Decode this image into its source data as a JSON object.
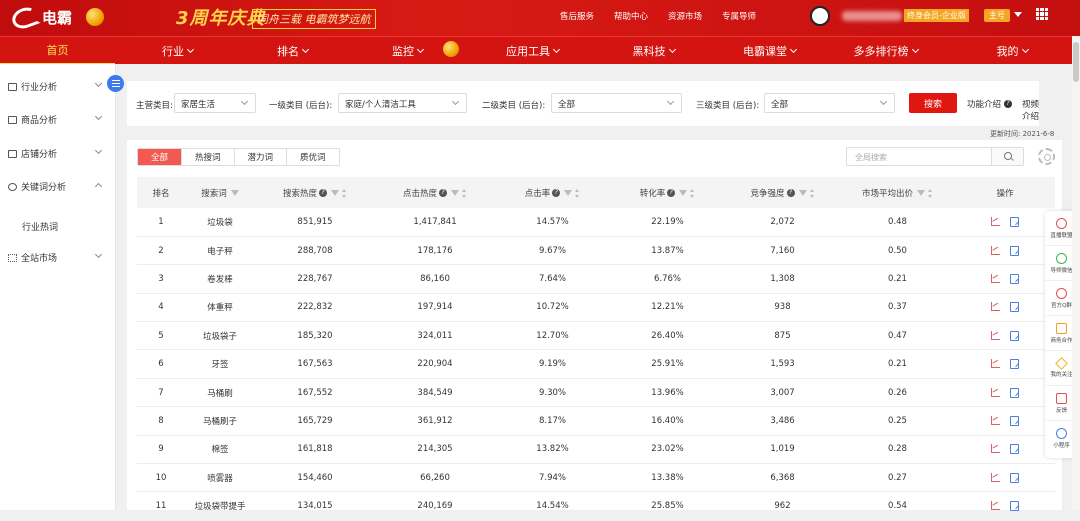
{
  "brand": {
    "logo_text": "电霸",
    "anniv_main": "3周年庆典",
    "anniv_sub": "同舟三载 电霸筑梦远航"
  },
  "top_links": [
    "售后服务",
    "帮助中心",
    "资源市场",
    "专属导师"
  ],
  "user": {
    "vip": "终身会员-企业版",
    "main_badge": "主号"
  },
  "nav": [
    {
      "label": "首页",
      "active": true,
      "has_caret": false
    },
    {
      "label": "行业",
      "has_caret": true
    },
    {
      "label": "排名",
      "has_caret": true
    },
    {
      "label": "监控",
      "has_caret": true
    },
    {
      "label": "应用工具",
      "has_caret": true
    },
    {
      "label": "黑科技",
      "has_caret": true
    },
    {
      "label": "电霸课堂",
      "has_caret": true
    },
    {
      "label": "多多排行榜",
      "has_caret": true
    },
    {
      "label": "我的",
      "has_caret": true
    }
  ],
  "sidebar": {
    "items": [
      {
        "label": "行业分析"
      },
      {
        "label": "商品分析"
      },
      {
        "label": "店铺分析"
      },
      {
        "label": "关键词分析"
      },
      {
        "label": "全站市场"
      }
    ],
    "sub_item": "行业热词"
  },
  "filters": {
    "main_label": "主营类目:",
    "main_value": "家居生活",
    "l1_label": "一级类目 (后台):",
    "l1_value": "家庭/个人清洁工具",
    "l2_label": "二级类目 (后台):",
    "l2_value": "全部",
    "l3_label": "三级类目 (后台):",
    "l3_value": "全部",
    "search_btn": "搜索",
    "func_intro": "功能介绍",
    "video_intro": "视频介绍"
  },
  "update_time": "更新时间: 2021-6-8",
  "tabs": [
    "全部",
    "热搜词",
    "潜力词",
    "质优词"
  ],
  "global_search_placeholder": "全局搜索",
  "table": {
    "headers": [
      "排名",
      "搜索词",
      "搜索热度",
      "点击热度",
      "点击率",
      "转化率",
      "竞争强度",
      "市场平均出价",
      "操作"
    ],
    "rows": [
      [
        "1",
        "垃圾袋",
        "851,915",
        "1,417,841",
        "14.57%",
        "22.19%",
        "2,072",
        "0.48"
      ],
      [
        "2",
        "电子秤",
        "288,708",
        "178,176",
        "9.67%",
        "13.87%",
        "7,160",
        "0.50"
      ],
      [
        "3",
        "卷发棒",
        "228,767",
        "86,160",
        "7.64%",
        "6.76%",
        "1,308",
        "0.21"
      ],
      [
        "4",
        "体重秤",
        "222,832",
        "197,914",
        "10.72%",
        "12.21%",
        "938",
        "0.37"
      ],
      [
        "5",
        "垃圾袋子",
        "185,320",
        "324,011",
        "12.70%",
        "26.40%",
        "875",
        "0.47"
      ],
      [
        "6",
        "牙签",
        "167,563",
        "220,904",
        "9.19%",
        "25.91%",
        "1,593",
        "0.21"
      ],
      [
        "7",
        "马桶刷",
        "167,552",
        "384,549",
        "9.30%",
        "13.96%",
        "3,007",
        "0.26"
      ],
      [
        "8",
        "马桶刷子",
        "165,729",
        "361,912",
        "8.17%",
        "16.40%",
        "3,486",
        "0.25"
      ],
      [
        "9",
        "棉签",
        "161,818",
        "214,305",
        "13.82%",
        "23.02%",
        "1,019",
        "0.28"
      ],
      [
        "10",
        "喷雾器",
        "154,460",
        "66,260",
        "7.94%",
        "13.38%",
        "6,368",
        "0.27"
      ],
      [
        "11",
        "垃圾袋带提手",
        "134,015",
        "240,169",
        "14.54%",
        "25.85%",
        "962",
        "0.54"
      ]
    ]
  },
  "right_tools": [
    "直播联盟",
    "导师微信",
    "官方Q群",
    "商务合作",
    "我的关注",
    "反馈",
    "小程序"
  ]
}
